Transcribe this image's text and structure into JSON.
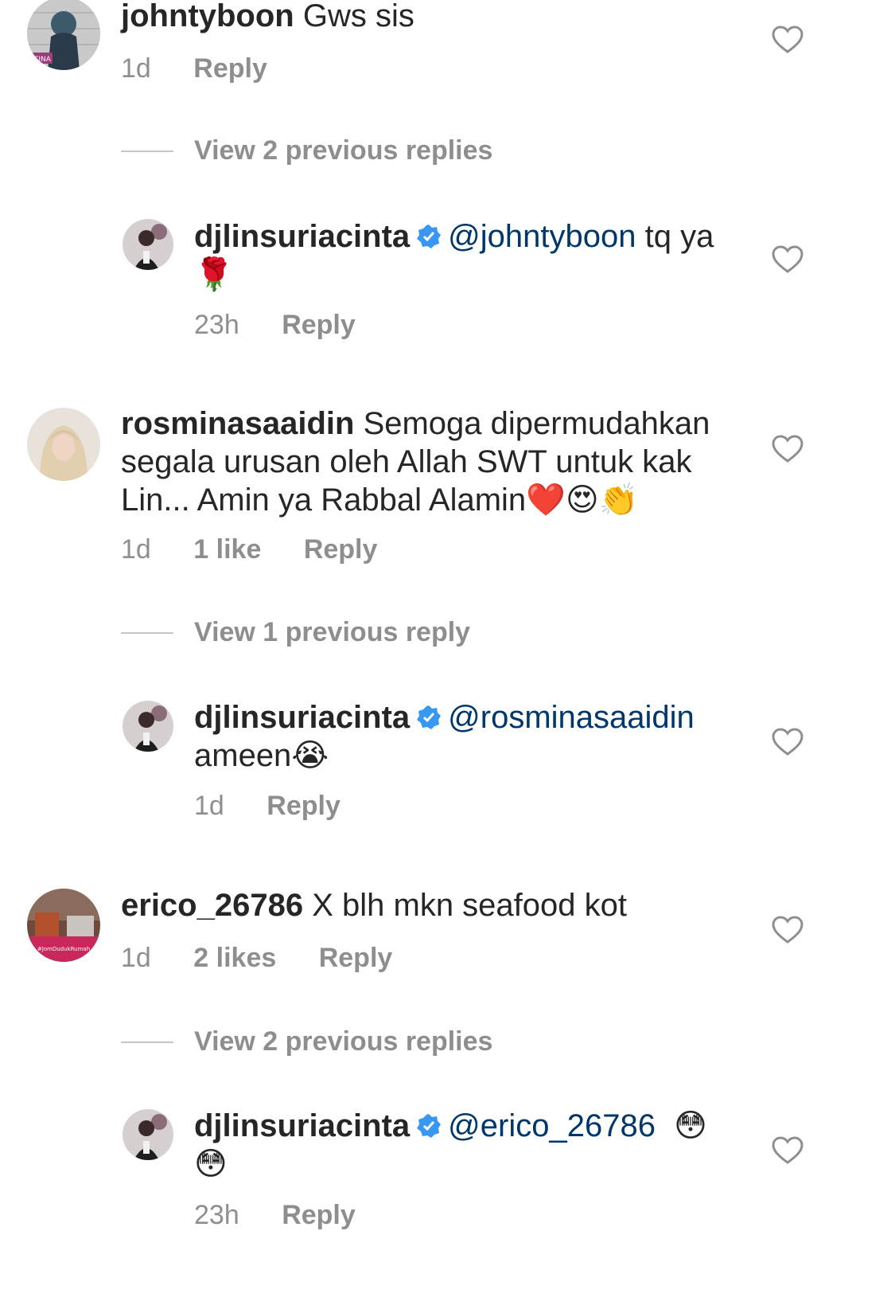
{
  "comments": [
    {
      "username": "johntyboon",
      "text": "Gws sis",
      "time": "1d",
      "likes": "",
      "reply_label": "Reply",
      "avatar_label": "CINA",
      "view_replies": "View 2 previous replies",
      "reply": {
        "username": "djlinsuriacinta",
        "mention": "@johntyboon",
        "text": "tq ya",
        "emoji": "🌹",
        "time": "23h",
        "reply_label": "Reply"
      }
    },
    {
      "username": "rosminasaaidin",
      "text_line1": "Semoga dipermudahkan",
      "text_line2": "segala urusan oleh Allah SWT untuk kak",
      "text_line3": "Lin... Amin ya Rabbal Alamin",
      "emoji": "❤️😍👏",
      "time": "1d",
      "likes": "1 like",
      "reply_label": "Reply",
      "view_replies": "View 1 previous reply",
      "reply": {
        "username": "djlinsuriacinta",
        "mention": "@rosminasaaidin",
        "text": "ameen",
        "emoji": "😭",
        "time": "1d",
        "reply_label": "Reply"
      }
    },
    {
      "username": "erico_26786",
      "text": "X blh mkn seafood kot",
      "time": "1d",
      "likes": "2 likes",
      "reply_label": "Reply",
      "avatar_label": "#JomDudukRumah",
      "view_replies": "View 2 previous replies",
      "reply": {
        "username": "djlinsuriacinta",
        "mention": "@erico_26786",
        "emoji": "😳",
        "emoji2": "😳",
        "time": "23h",
        "reply_label": "Reply"
      }
    }
  ],
  "colors": {
    "text": "#262626",
    "meta": "#8e8e8e",
    "mention": "#00376b",
    "verified": "#3897f0"
  }
}
